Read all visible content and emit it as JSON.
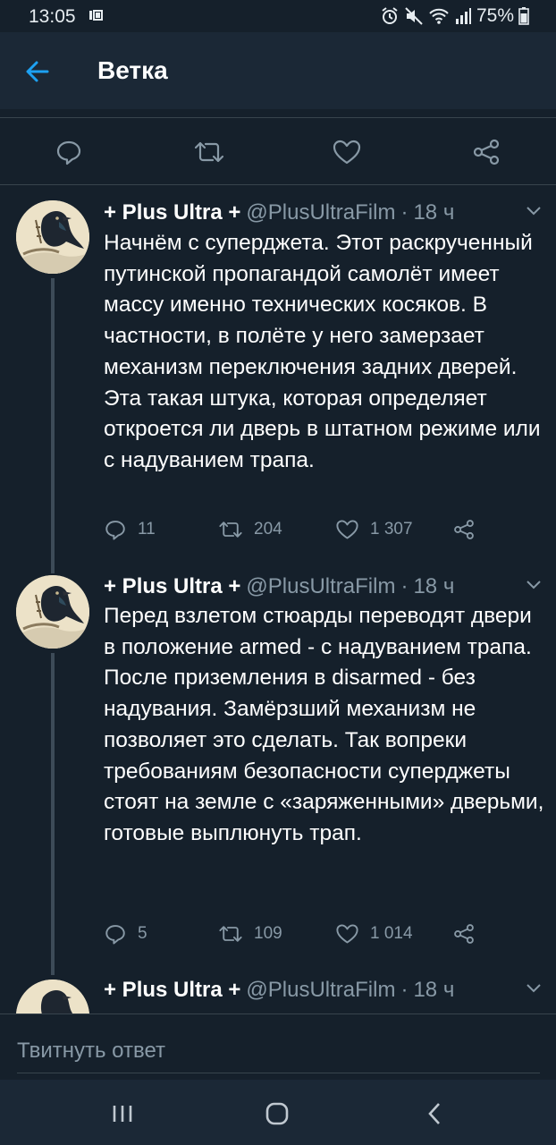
{
  "status_bar": {
    "time": "13:05",
    "battery": "75%"
  },
  "header": {
    "title": "Ветка"
  },
  "reply_box": {
    "placeholder": "Твитнуть ответ"
  },
  "tweets": [
    {
      "name": "+ Plus Ultra +",
      "handle": "@PlusUltraFilm",
      "sep": "·",
      "time": "18 ч",
      "text": "Начнём с суперджета. Этот раскрученный путинской пропагандой самолёт имеет массу именно технических косяков. В частности, в полёте у него замерзает механизм переключения задних дверей. Эта такая штука, которая определяет откроется ли дверь в штатном режиме или с надуванием трапа.",
      "replies": "11",
      "retweets": "204",
      "likes": "1 307"
    },
    {
      "name": "+ Plus Ultra +",
      "handle": "@PlusUltraFilm",
      "sep": "·",
      "time": "18 ч",
      "text": "Перед взлетом стюарды переводят двери в положение armed - с надуванием трапа. После приземления в disarmed - без надувания. Замёрзший механизм не позволяет это сделать. Так вопреки требованиям безопасности суперджеты стоят на земле с «заряженными» дверьми, готовые выплюнуть трап.",
      "replies": "5",
      "retweets": "109",
      "likes": "1 014"
    },
    {
      "name": "+ Plus Ultra +",
      "handle": "@PlusUltraFilm",
      "sep": "·",
      "time": "18 ч"
    }
  ]
}
